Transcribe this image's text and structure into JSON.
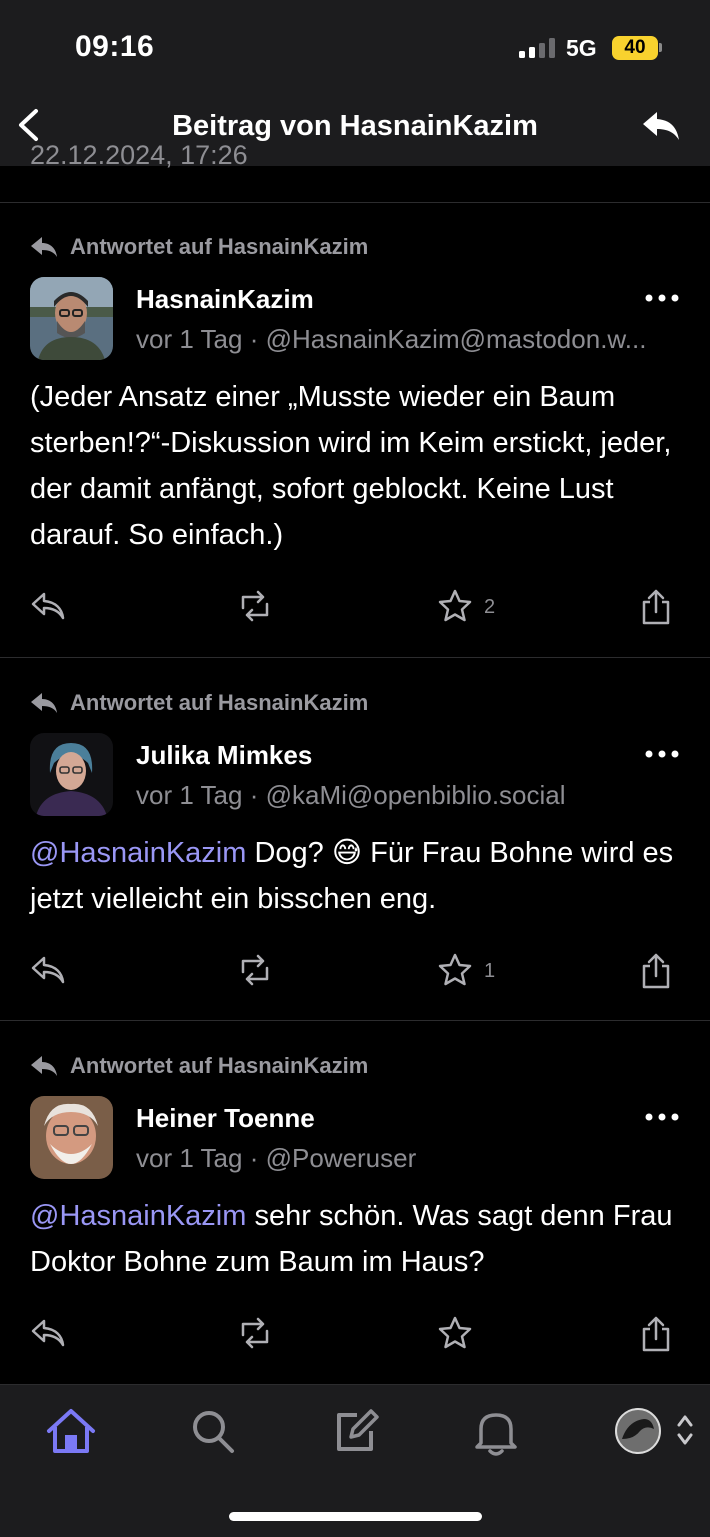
{
  "status_bar": {
    "time": "09:16",
    "network": "5G",
    "battery": "40"
  },
  "nav": {
    "title": "Beitrag von HasnainKazim",
    "back_icon": "chevron-left-icon",
    "reply_icon": "reply-all-icon"
  },
  "peek_timestamp": "22.12.2024, 17:26",
  "posts": [
    {
      "context": "Antwortet auf HasnainKazim",
      "name": "HasnainKazim",
      "time": "vor 1 Tag",
      "handle": "@HasnainKazim@mastodon.w...",
      "mention": "",
      "text": "(Jeder Ansatz einer „Musste wieder ein Baum sterben!?“-Diskussion wird im Keim erstickt, jeder, der damit anfängt, sofort geblockt. Keine Lust darauf. So einfach.)",
      "favorites": "2"
    },
    {
      "context": "Antwortet auf HasnainKazim",
      "name": "Julika Mimkes",
      "time": "vor 1 Tag",
      "handle": "@kaMi@openbiblio.social",
      "mention": "@HasnainKazim",
      "text": " Dog? 😅 Für Frau Bohne wird es jetzt vielleicht ein bisschen eng.",
      "favorites": "1"
    },
    {
      "context": "Antwortet auf HasnainKazim",
      "name": "Heiner Toenne",
      "time": "vor 1 Tag",
      "handle": "@Poweruser",
      "mention": "@HasnainKazim",
      "text": " sehr schön. Was sagt denn Frau Doktor Bohne zum Baum im Haus?",
      "favorites": ""
    }
  ],
  "meta_separator": " · ",
  "tab_bar": {
    "items": [
      "home-icon",
      "search-icon",
      "compose-icon",
      "notifications-icon",
      "profile-avatar"
    ],
    "active": "home-icon"
  },
  "colors": {
    "accent": "#7b79f5",
    "mention": "#9a97f5",
    "background": "#000000",
    "bar": "#1c1c1e",
    "secondary_text": "#8e8e93"
  }
}
